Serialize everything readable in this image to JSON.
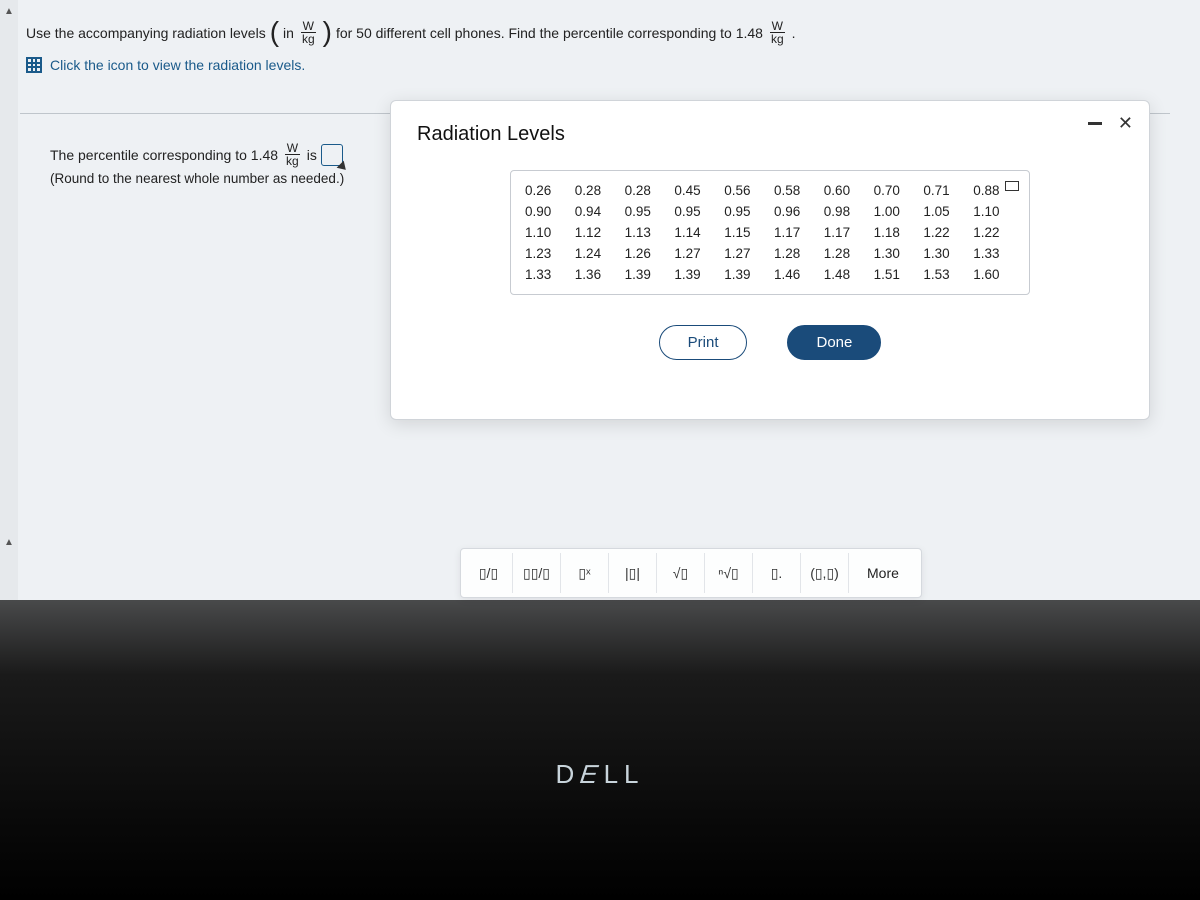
{
  "question": {
    "prefix": "Use the accompanying radiation levels",
    "paren_in": "in",
    "unit_num": "W",
    "unit_den": "kg",
    "middle": "for 50 different cell phones. Find the percentile corresponding to 1.48",
    "unit2_num": "W",
    "unit2_den": "kg",
    "period": "."
  },
  "icon_link": "Click the icon to view the radiation levels.",
  "answer": {
    "prefix": "The percentile corresponding to 1.48",
    "unit_num": "W",
    "unit_den": "kg",
    "suffix": "is",
    "round_note": "(Round to the nearest whole number as needed.)"
  },
  "modal": {
    "title": "Radiation Levels",
    "data": [
      "0.26",
      "0.28",
      "0.28",
      "0.45",
      "0.56",
      "0.58",
      "0.60",
      "0.70",
      "0.71",
      "0.88",
      "0.90",
      "0.94",
      "0.95",
      "0.95",
      "0.95",
      "0.96",
      "0.98",
      "1.00",
      "1.05",
      "1.10",
      "1.10",
      "1.12",
      "1.13",
      "1.14",
      "1.15",
      "1.17",
      "1.17",
      "1.18",
      "1.22",
      "1.22",
      "1.23",
      "1.24",
      "1.26",
      "1.27",
      "1.27",
      "1.28",
      "1.28",
      "1.30",
      "1.30",
      "1.33",
      "1.33",
      "1.36",
      "1.39",
      "1.39",
      "1.39",
      "1.46",
      "1.48",
      "1.51",
      "1.53",
      "1.60"
    ],
    "print": "Print",
    "done": "Done"
  },
  "toolbar": {
    "b1": "▯/▯",
    "b2": "▯▯/▯",
    "b3": "▯ˣ",
    "b4": "|▯|",
    "b5": "√▯",
    "b6": "ⁿ√▯",
    "b7": "▯.",
    "b8": "(▯,▯)",
    "more": "More"
  },
  "dell": "D⌶LL",
  "chart_data": {
    "type": "table",
    "title": "Radiation Levels",
    "rows": 5,
    "cols": 10,
    "values": [
      [
        0.26,
        0.28,
        0.28,
        0.45,
        0.56,
        0.58,
        0.6,
        0.7,
        0.71,
        0.88
      ],
      [
        0.9,
        0.94,
        0.95,
        0.95,
        0.95,
        0.96,
        0.98,
        1.0,
        1.05,
        1.1
      ],
      [
        1.1,
        1.12,
        1.13,
        1.14,
        1.15,
        1.17,
        1.17,
        1.18,
        1.22,
        1.22
      ],
      [
        1.23,
        1.24,
        1.26,
        1.27,
        1.27,
        1.28,
        1.28,
        1.3,
        1.3,
        1.33
      ],
      [
        1.33,
        1.36,
        1.39,
        1.39,
        1.39,
        1.46,
        1.48,
        1.51,
        1.53,
        1.6
      ]
    ],
    "target_value": 1.48,
    "n": 50,
    "unit": "W/kg"
  }
}
